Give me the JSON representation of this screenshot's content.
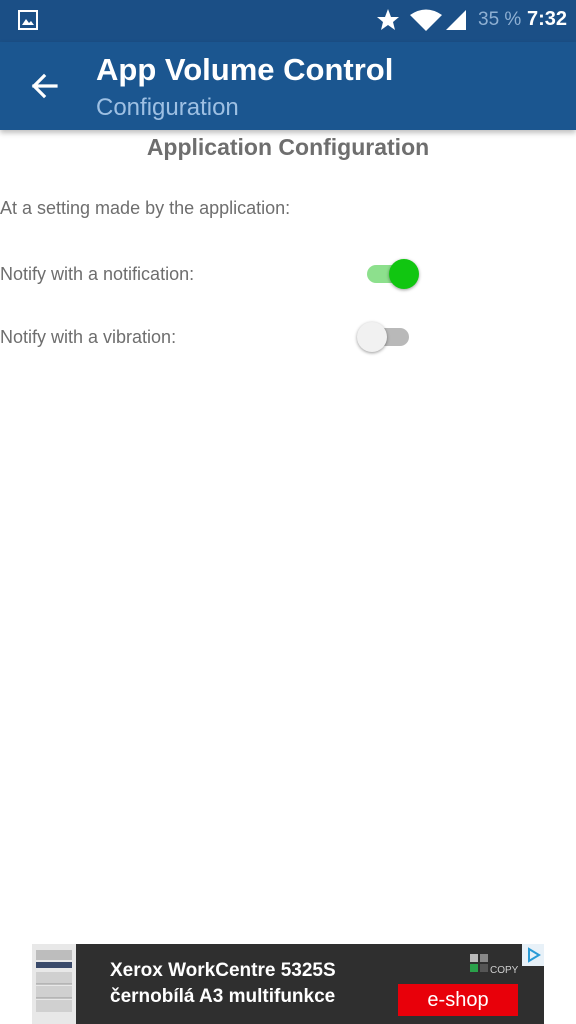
{
  "status_bar": {
    "icons": [
      "gallery-icon",
      "star-icon",
      "wifi-icon",
      "signal-icon"
    ],
    "battery": "35 %",
    "time": "7:32"
  },
  "app_bar": {
    "back_icon": "arrow-left-icon",
    "title": "App Volume Control",
    "subtitle": "Configuration",
    "color": "#1b5690"
  },
  "content": {
    "section_title": "Application Configuration",
    "intro": "At a setting made by the application:",
    "settings": [
      {
        "label": "Notify with a notification:",
        "enabled": true
      },
      {
        "label": "Notify with a vibration:",
        "enabled": false
      }
    ],
    "accent_color": "#11c611"
  },
  "ad": {
    "line1": "Xerox WorkCentre 5325S",
    "line2": "černobílá A3 multifunkce",
    "logo_text": "COPY",
    "cta": "e-shop",
    "cta_color": "#e8000a",
    "icons": [
      "printer-image",
      "ad-choices-icon"
    ]
  }
}
